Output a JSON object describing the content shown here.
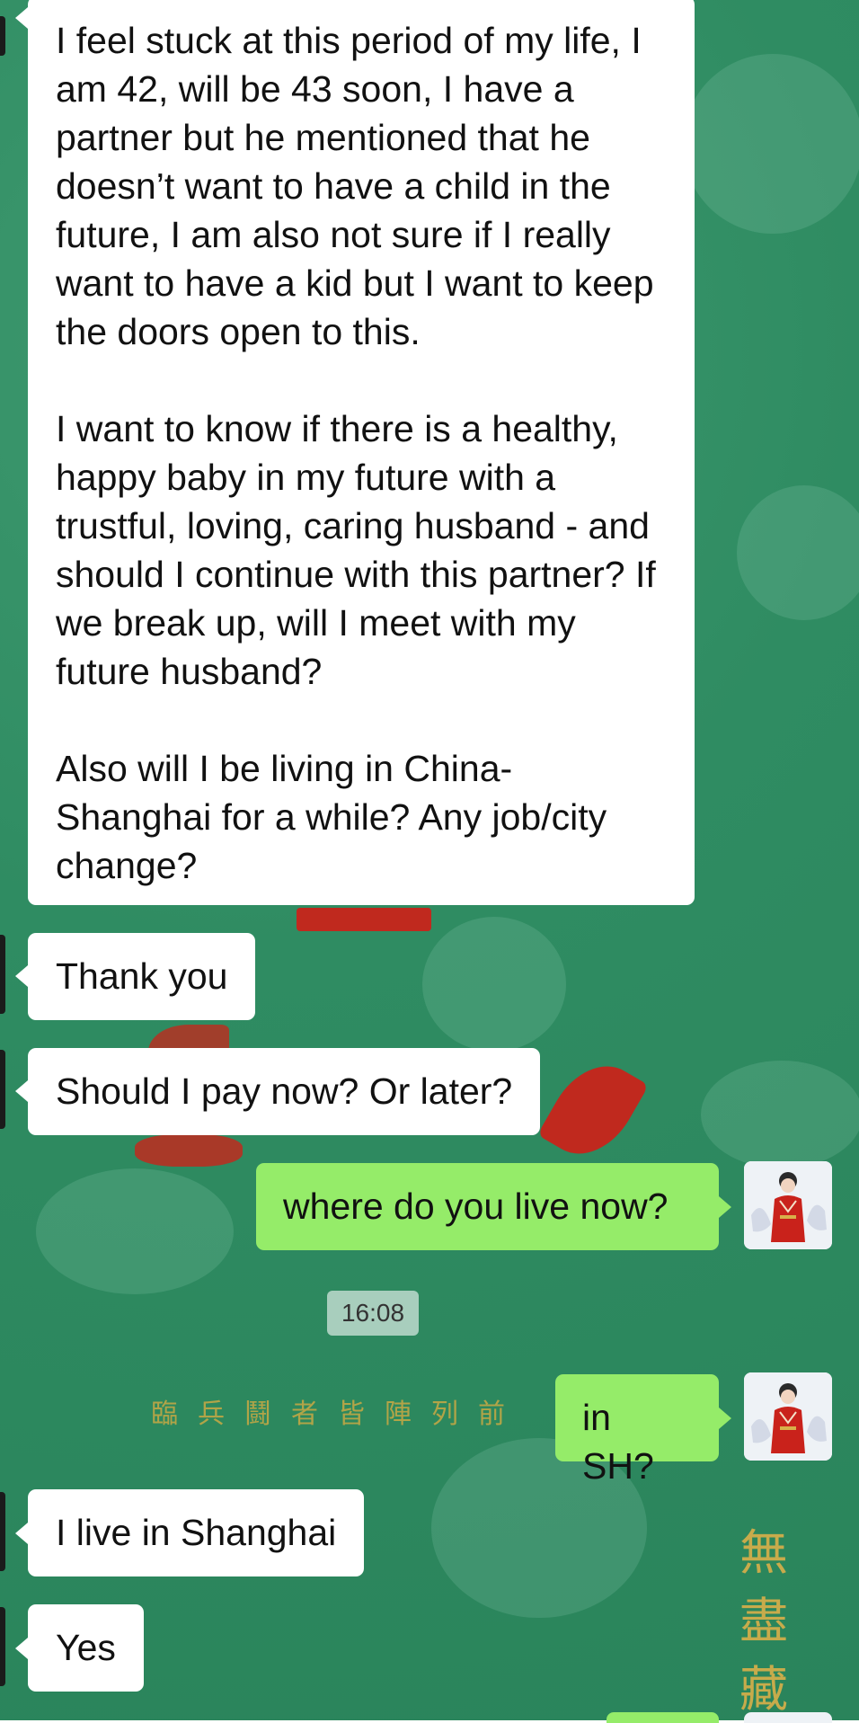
{
  "chat": {
    "messages": [
      {
        "side": "in",
        "text": "I feel stuck at this period of my life, I am 42, will be 43 soon, I have a partner but he mentioned that he doesn’t want to have a child in the future, I am also not sure if I really want to have a kid but I want to keep the doors open to this.\n\nI want to know if there is a healthy, happy baby in my future with a trustful, loving, caring husband - and should I continue with this partner? If we break up, will I meet with my future husband?\n\nAlso will I be living in China-Shanghai for a while? Any job/city change?"
      },
      {
        "side": "in",
        "text": "Thank you"
      },
      {
        "side": "in",
        "text": "Should I pay now? Or later?"
      },
      {
        "side": "out",
        "text": "where do you live now?"
      },
      {
        "side": "out",
        "text": "in SH?"
      },
      {
        "side": "in",
        "text": "I live in Shanghai"
      },
      {
        "side": "in",
        "text": "Yes"
      }
    ],
    "timestamp": "16:08"
  },
  "background": {
    "chars_row": "臨兵鬪者皆陣列前",
    "chars_vertical": "無盡藏"
  },
  "colors": {
    "chat_background": "#2f8c62",
    "incoming_bubble": "#ffffff",
    "outgoing_bubble": "#95ec69",
    "background_accent_red": "#c8241a",
    "background_accent_gold": "#d9b04a"
  },
  "icons": {
    "avatar": "user-avatar-icon"
  }
}
